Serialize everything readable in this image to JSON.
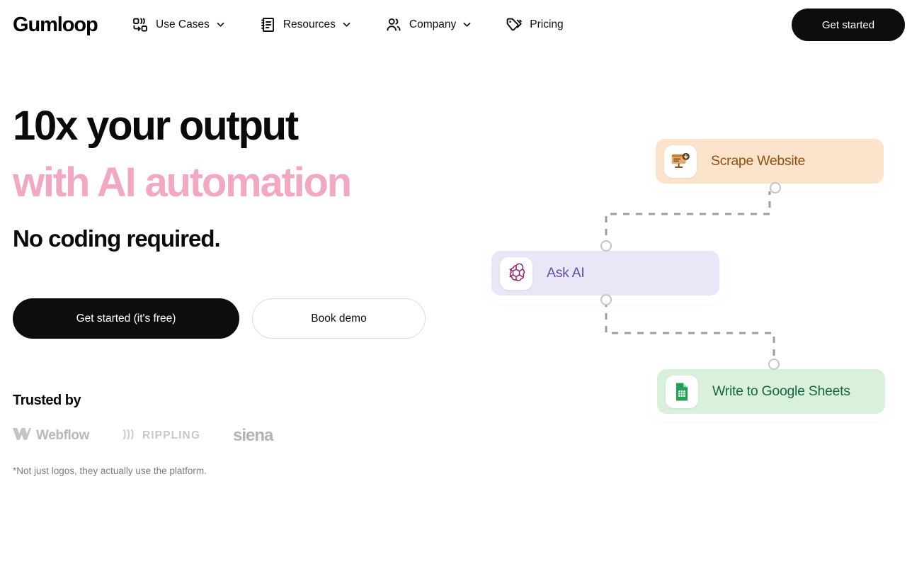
{
  "brand": {
    "name": "Gumloop"
  },
  "nav": {
    "items": [
      {
        "label": "Use Cases",
        "icon": "workflow-icon",
        "has_chevron": true
      },
      {
        "label": "Resources",
        "icon": "book-icon",
        "has_chevron": true
      },
      {
        "label": "Company",
        "icon": "people-icon",
        "has_chevron": true
      },
      {
        "label": "Pricing",
        "icon": "tag-icon",
        "has_chevron": false
      }
    ],
    "cta": {
      "label": "Get started"
    }
  },
  "hero": {
    "heading_line1": "10x your output",
    "heading_line2": "with AI automation",
    "subheading": "No coding required.",
    "accent_color": "#f2a7c3",
    "primary_button": "Get started (it's free)",
    "secondary_button": "Book demo"
  },
  "trusted": {
    "title": "Trusted by",
    "logos": [
      {
        "name": "Webflow"
      },
      {
        "name": "RIPPLING"
      },
      {
        "name": "siena"
      }
    ],
    "footnote": "*Not just logos, they actually use the platform."
  },
  "workflow": {
    "nodes": [
      {
        "id": "scrape",
        "label": "Scrape Website",
        "icon": "monitor-download-icon",
        "bg_color": "#fbe4cb",
        "text_color": "#92500f"
      },
      {
        "id": "askai",
        "label": "Ask AI",
        "icon": "openai-icon",
        "bg_color": "#eae5f7",
        "text_color": "#5c52a8"
      },
      {
        "id": "sheets",
        "label": "Write to Google Sheets",
        "icon": "google-sheets-icon",
        "bg_color": "#d9f0dd",
        "text_color": "#15693c"
      }
    ],
    "connector_style": "dashed",
    "connector_color": "#9e9e9e"
  }
}
